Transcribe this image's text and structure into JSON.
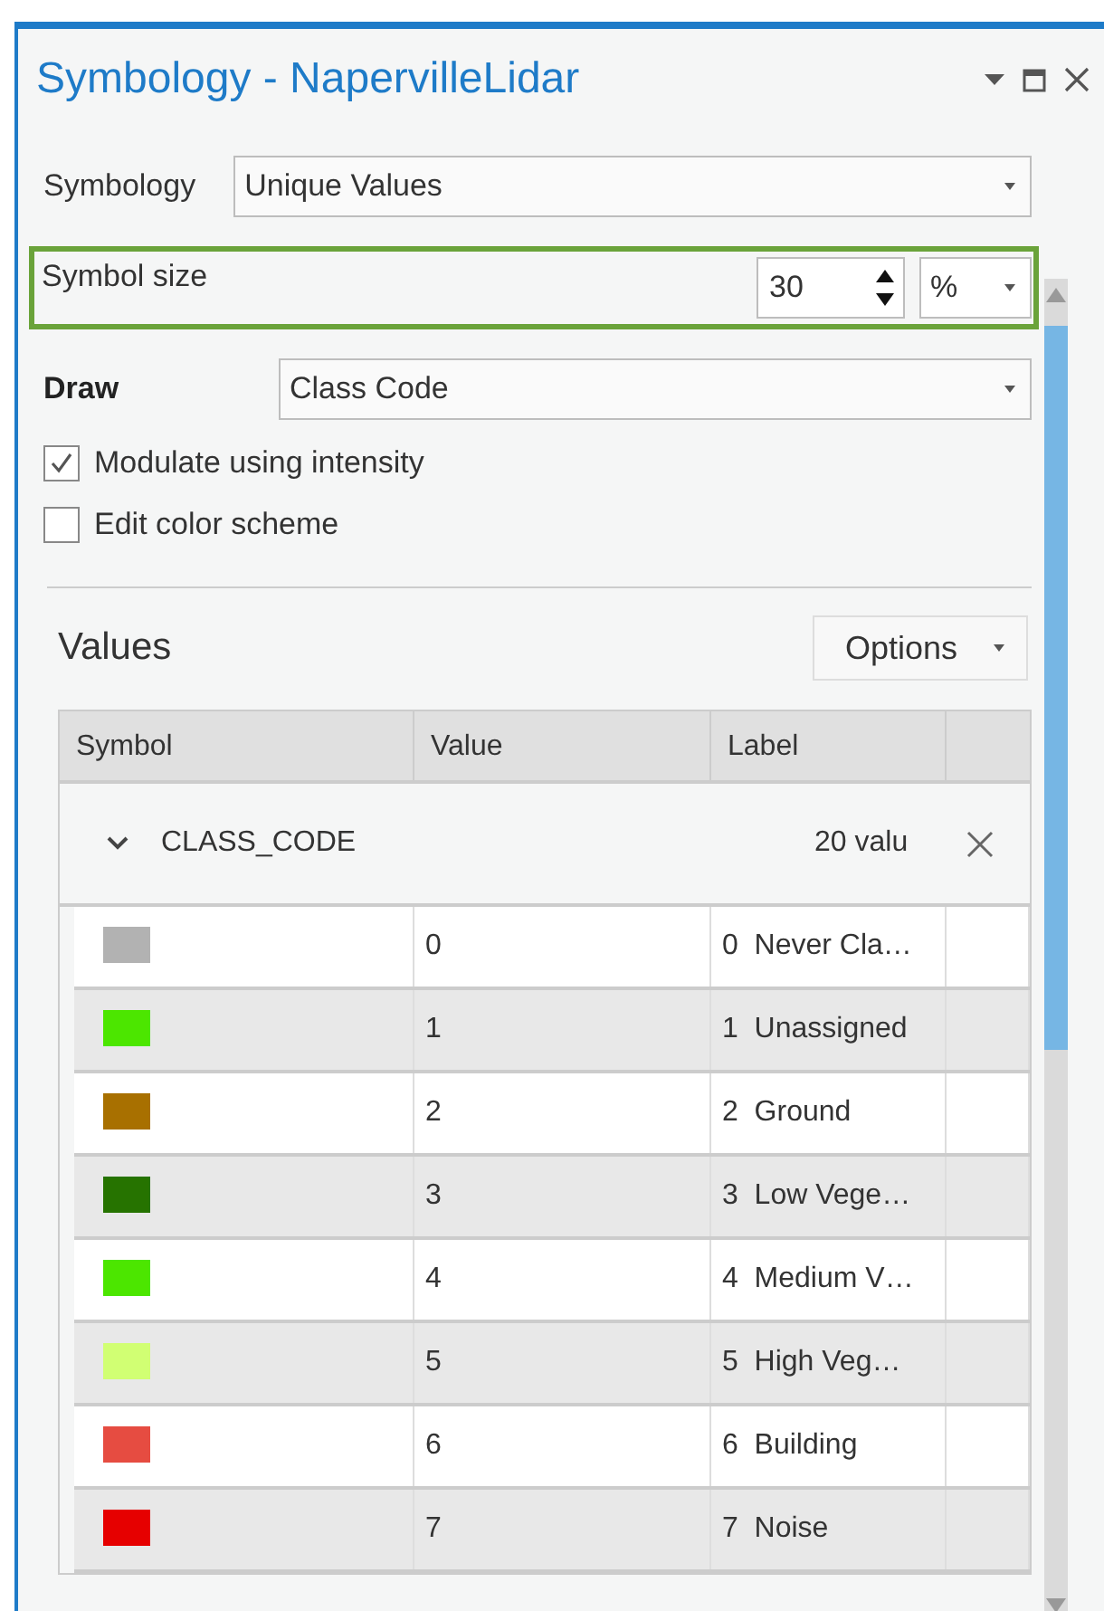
{
  "window": {
    "title": "Symbology - NapervilleLidar"
  },
  "symbology": {
    "label": "Symbology",
    "value": "Unique Values"
  },
  "symbol_size": {
    "label": "Symbol size",
    "value": "30",
    "unit": "%"
  },
  "draw": {
    "label": "Draw",
    "value": "Class Code"
  },
  "checkboxes": [
    {
      "label": "Modulate using intensity",
      "checked": true
    },
    {
      "label": "Edit color scheme",
      "checked": false
    }
  ],
  "values": {
    "title": "Values",
    "options_button": "Options"
  },
  "table": {
    "columns": [
      "Symbol",
      "Value",
      "Label"
    ],
    "group": {
      "field": "CLASS_CODE",
      "count": "20 valu",
      "expanded": true
    },
    "rows": [
      {
        "value": "0",
        "label": "0  Never Cla…",
        "color": "#b2b2b2"
      },
      {
        "value": "1",
        "label": "1  Unassigned",
        "color": "#4ce600"
      },
      {
        "value": "2",
        "label": "2  Ground",
        "color": "#a87000"
      },
      {
        "value": "3",
        "label": "3  Low Vege…",
        "color": "#267300"
      },
      {
        "value": "4",
        "label": "4  Medium V…",
        "color": "#4ce600"
      },
      {
        "value": "5",
        "label": "5  High Veg…",
        "color": "#d1ff73"
      },
      {
        "value": "6",
        "label": "6  Building",
        "color": "#e64c41"
      },
      {
        "value": "7",
        "label": "7  Noise",
        "color": "#e60000"
      }
    ]
  }
}
